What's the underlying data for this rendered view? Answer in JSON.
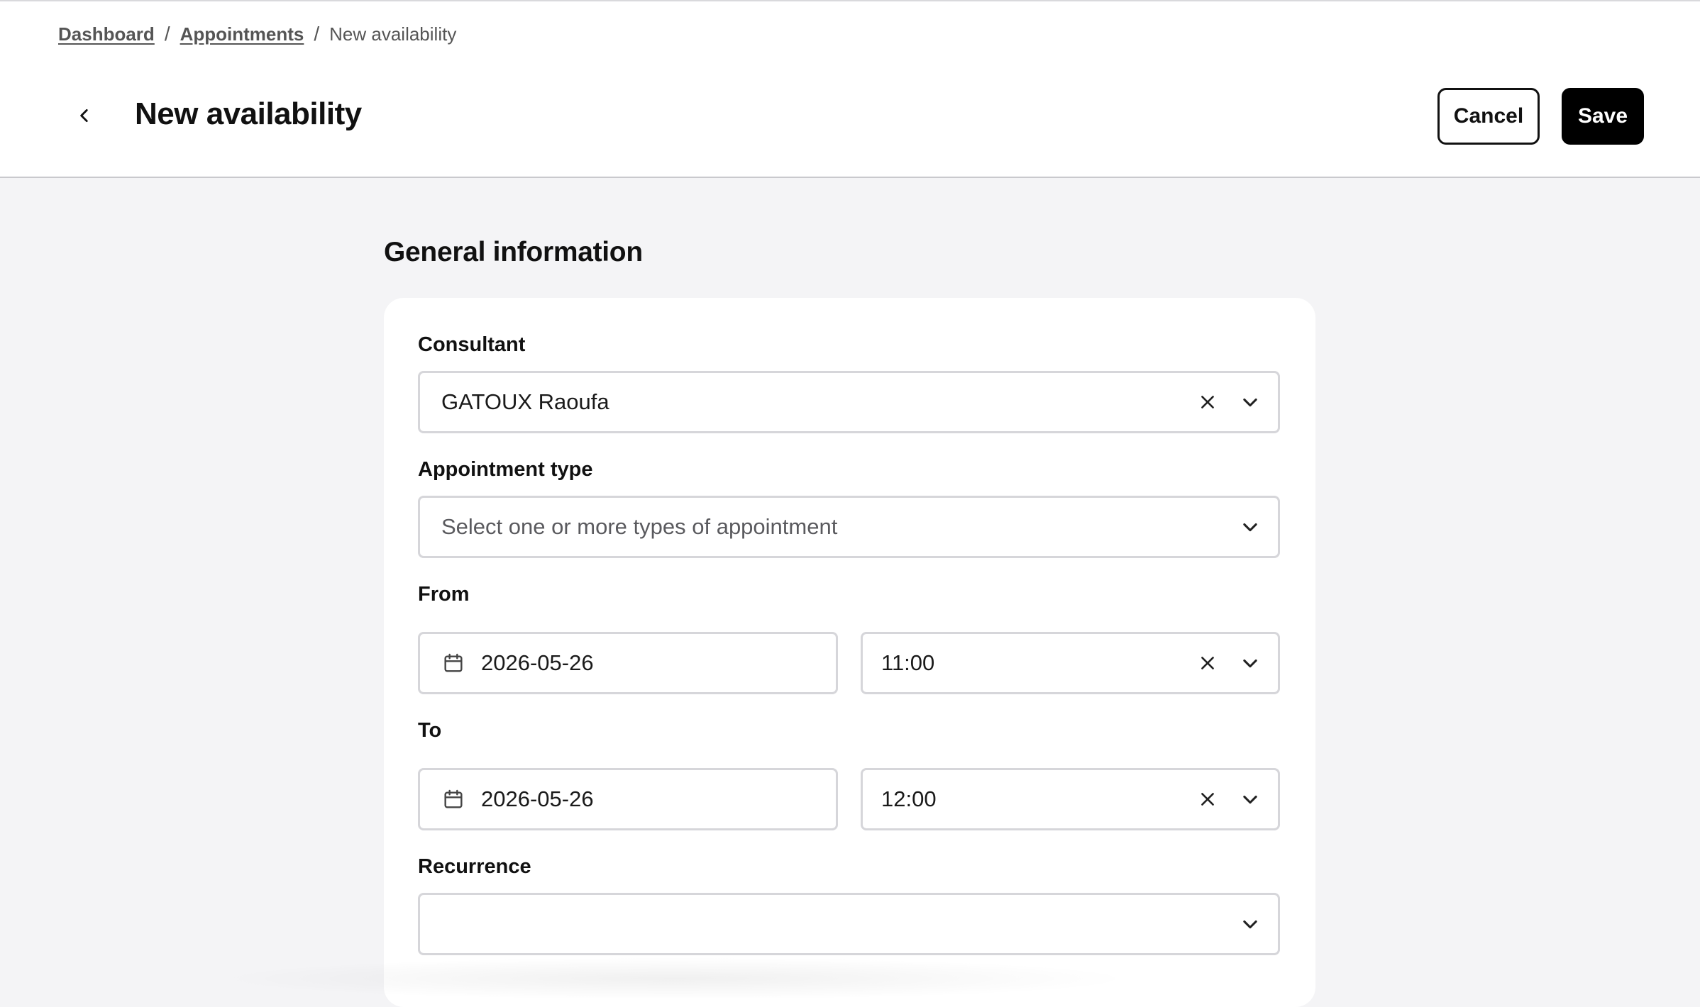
{
  "breadcrumb": {
    "items": [
      "Dashboard",
      "Appointments"
    ],
    "current": "New availability",
    "separator": "/"
  },
  "header": {
    "title": "New availability",
    "cancel_label": "Cancel",
    "save_label": "Save"
  },
  "section": {
    "title": "General information"
  },
  "form": {
    "consultant": {
      "label": "Consultant",
      "value": "GATOUX Raoufa"
    },
    "appointment_type": {
      "label": "Appointment type",
      "placeholder": "Select one or more types of appointment"
    },
    "from": {
      "label": "From",
      "date": "2026-05-26",
      "time": "11:00"
    },
    "to": {
      "label": "To",
      "date": "2026-05-26",
      "time": "12:00"
    },
    "recurrence": {
      "label": "Recurrence",
      "value": ""
    }
  },
  "icons": {
    "back": "chevron-left-icon",
    "clear": "close-icon",
    "dropdown": "chevron-down-icon",
    "date": "calendar-icon"
  },
  "colors": {
    "page_bg": "#f4f4f6",
    "primary": "#000000",
    "field_border": "#d6d6da"
  }
}
